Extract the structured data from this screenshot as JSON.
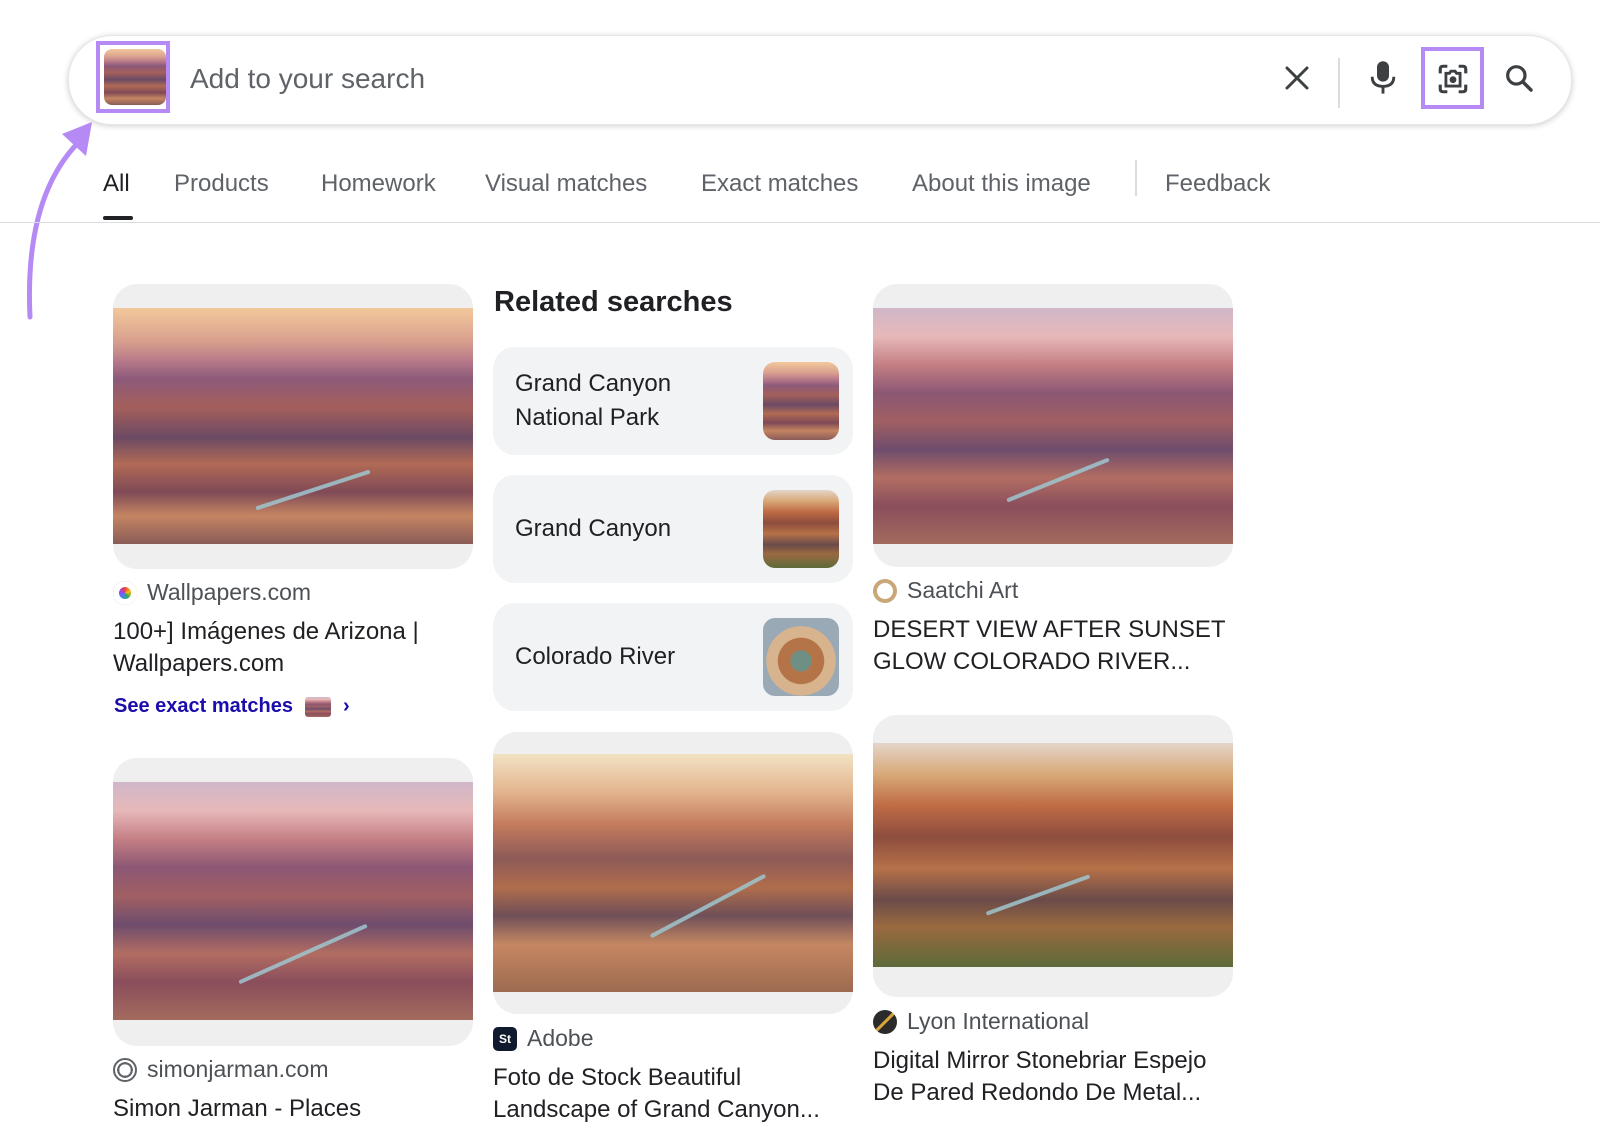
{
  "search": {
    "placeholder": "Add to your search",
    "query_image": "grand-canyon-thumbnail",
    "icons": [
      "close-icon",
      "mic-icon",
      "lens-icon",
      "search-icon"
    ]
  },
  "tabs": [
    {
      "label": "All",
      "active": true
    },
    {
      "label": "Products"
    },
    {
      "label": "Homework"
    },
    {
      "label": "Visual matches"
    },
    {
      "label": "Exact matches"
    },
    {
      "label": "About this image"
    },
    {
      "label": "Feedback"
    }
  ],
  "related": {
    "heading": "Related searches",
    "items": [
      {
        "label": "Grand Canyon National Park"
      },
      {
        "label": "Grand Canyon"
      },
      {
        "label": "Colorado River"
      }
    ]
  },
  "results": [
    {
      "source": "Wallpapers.com",
      "title": "100+] Imágenes de Arizona | Wallpapers.com",
      "exact_link": "See exact matches"
    },
    {
      "source": "Saatchi Art",
      "title": "DESERT VIEW AFTER SUNSET GLOW COLORADO RIVER..."
    },
    {
      "source": "simonjarman.com",
      "title": "Simon Jarman - Places"
    },
    {
      "source": "Adobe",
      "title": "Foto de Stock Beautiful Landscape of Grand Canyon..."
    },
    {
      "source": "Lyon International",
      "title": "Digital Mirror Stonebriar Espejo De Pared Redondo De Metal..."
    }
  ],
  "colors": {
    "highlight": "#b58af5",
    "link": "#1a0dab",
    "muted_text": "#5f6368"
  }
}
